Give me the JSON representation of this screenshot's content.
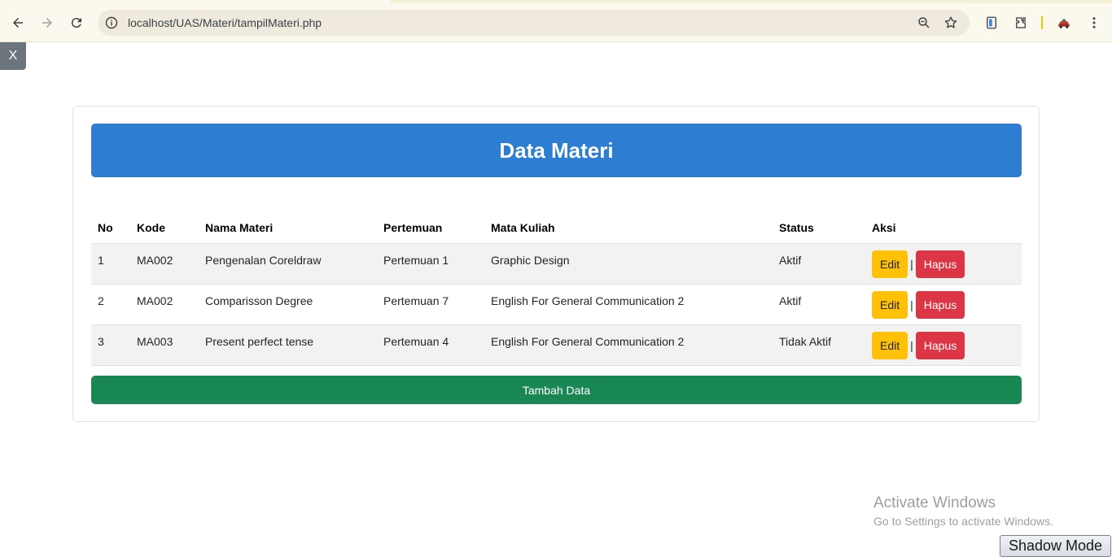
{
  "browser": {
    "url": "localhost/UAS/Materi/tampilMateri.php",
    "icons": [
      "back-icon",
      "forward-icon",
      "reload-icon",
      "site-info-icon",
      "zoom-icon",
      "bookmark-star-icon",
      "tab-search-icon",
      "extensions-icon",
      "profile-icon",
      "menu-icon"
    ]
  },
  "close_label": "X",
  "card": {
    "title": "Data Materi",
    "header_color": "#2d7dd2"
  },
  "table": {
    "columns": [
      "No",
      "Kode",
      "Nama Materi",
      "Pertemuan",
      "Mata Kuliah",
      "Status",
      "Aksi"
    ],
    "rows": [
      {
        "no": "1",
        "kode": "MA002",
        "nama": "Pengenalan Coreldraw",
        "pertemuan": "Pertemuan 1",
        "matkul": "Graphic Design",
        "status": "Aktif"
      },
      {
        "no": "2",
        "kode": "MA002",
        "nama": "Comparisson Degree",
        "pertemuan": "Pertemuan 7",
        "matkul": "English For General Communication 2",
        "status": "Aktif"
      },
      {
        "no": "3",
        "kode": "MA003",
        "nama": "Present perfect tense",
        "pertemuan": "Pertemuan 4",
        "matkul": "English For General Communication 2",
        "status": "Tidak Aktif"
      }
    ],
    "edit_label": "Edit",
    "separator": "|",
    "hapus_label": "Hapus"
  },
  "tambah_label": "Tambah Data",
  "watermark": {
    "title": "Activate Windows",
    "subtitle": "Go to Settings to activate Windows."
  },
  "shadow_mode_label": "Shadow Mode",
  "colors": {
    "edit": "#ffc107",
    "hapus": "#dc3545",
    "tambah": "#198754"
  }
}
